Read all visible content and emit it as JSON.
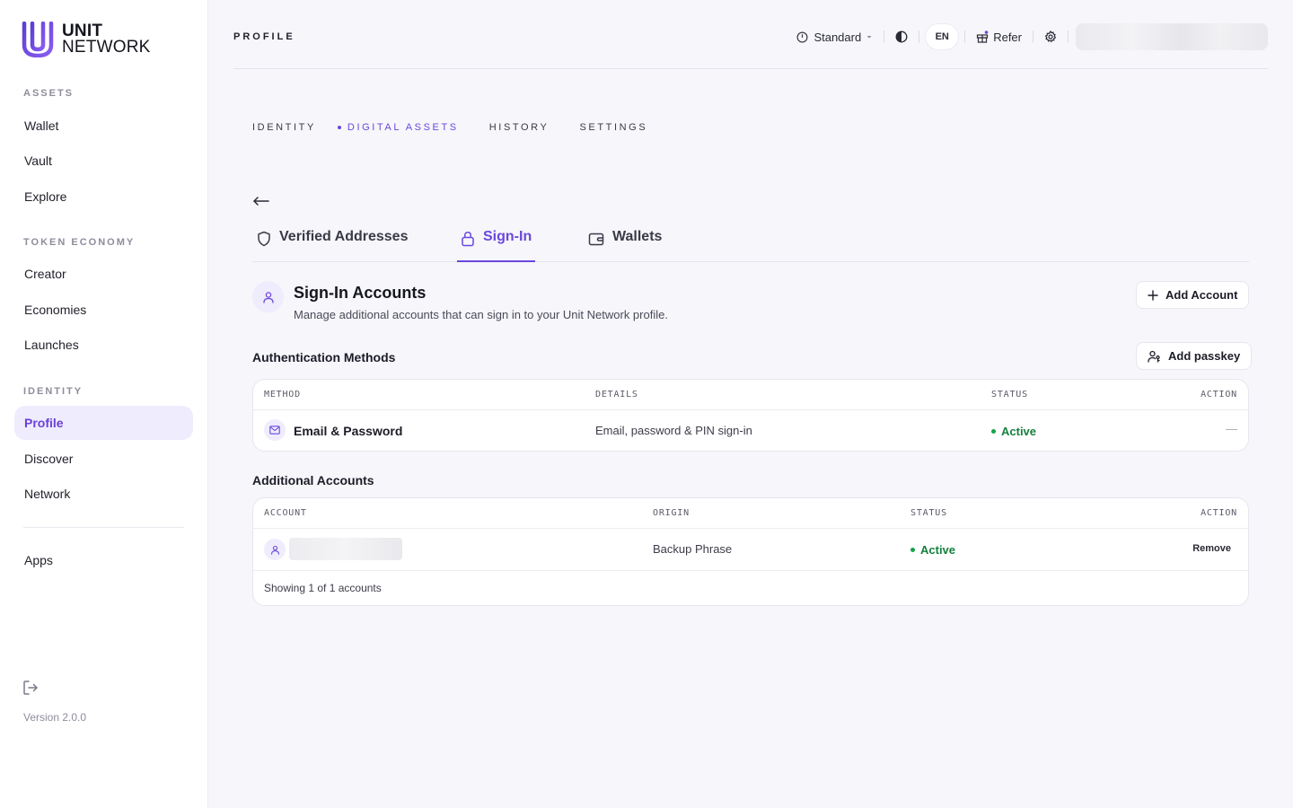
{
  "brand": {
    "line1": "UNIT",
    "line2": "NETWORK",
    "accent": "#6b47dc"
  },
  "sidebar": {
    "sections": [
      {
        "label": "ASSETS",
        "items": [
          "Wallet",
          "Vault",
          "Explore"
        ]
      },
      {
        "label": "TOKEN ECONOMY",
        "items": [
          "Creator",
          "Economies",
          "Launches"
        ]
      },
      {
        "label": "IDENTITY",
        "items": [
          "Profile",
          "Discover",
          "Network"
        ]
      }
    ],
    "extra_item": "Apps",
    "active_item": "Profile",
    "version": "Version 2.0.0"
  },
  "header": {
    "title": "PROFILE",
    "mode": "Standard",
    "lang": "EN",
    "refer": "Refer"
  },
  "main_tabs": [
    {
      "label": "IDENTITY",
      "active": false
    },
    {
      "label": "DIGITAL ASSETS",
      "active": true
    },
    {
      "label": "HISTORY",
      "active": false
    },
    {
      "label": "SETTINGS",
      "active": false
    }
  ],
  "sub_tabs": [
    {
      "label": "Verified Addresses",
      "icon": "shield-icon",
      "active": false
    },
    {
      "label": "Sign-In",
      "icon": "lock-icon",
      "active": true
    },
    {
      "label": "Wallets",
      "icon": "wallet-icon",
      "active": false
    }
  ],
  "signin": {
    "title": "Sign-In Accounts",
    "description": "Manage additional accounts that can sign in to your Unit Network profile.",
    "add_account": "Add Account"
  },
  "auth_methods": {
    "heading": "Authentication Methods",
    "add_passkey": "Add passkey",
    "columns": [
      "METHOD",
      "DETAILS",
      "STATUS",
      "ACTION"
    ],
    "rows": [
      {
        "method": "Email & Password",
        "details": "Email, password & PIN sign-in",
        "status": "Active",
        "action": "—"
      }
    ]
  },
  "additional_accounts": {
    "heading": "Additional Accounts",
    "columns": [
      "ACCOUNT",
      "ORIGIN",
      "STATUS",
      "ACTION"
    ],
    "rows": [
      {
        "origin": "Backup Phrase",
        "status": "Active",
        "action": "Remove"
      }
    ],
    "footer": "Showing 1 of 1 accounts"
  },
  "colors": {
    "status_active": "#15803d",
    "active_bg": "#efecfd"
  }
}
